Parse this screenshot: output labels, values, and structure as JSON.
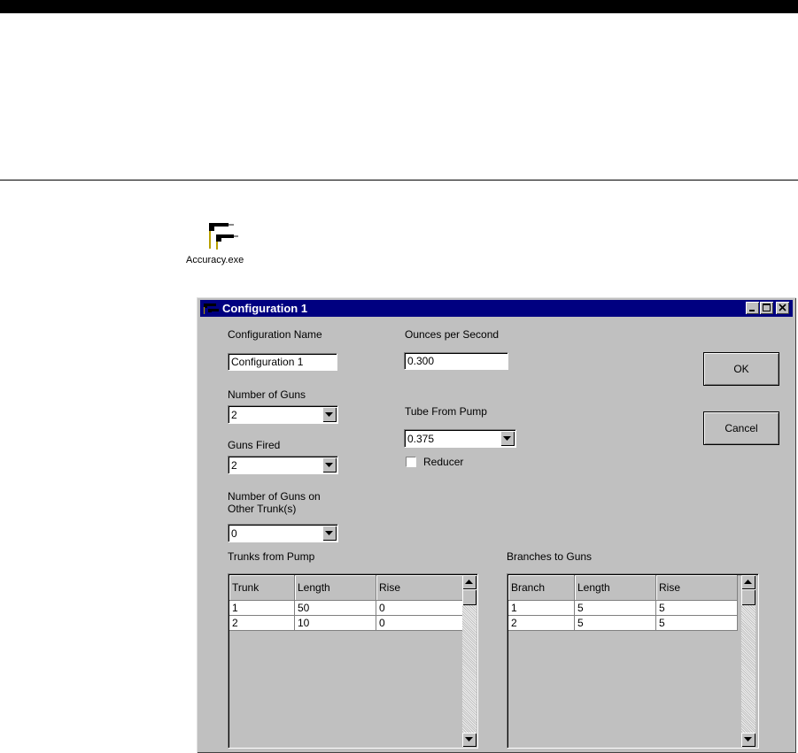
{
  "desktop": {
    "icon_label": "Accuracy.exe",
    "icon_name": "accuracy-app-icon"
  },
  "window": {
    "title": "Configuration 1",
    "controls": [
      "minimize",
      "maximize",
      "close"
    ]
  },
  "form": {
    "config_name_label": "Configuration Name",
    "config_name_value": "Configuration 1",
    "ounces_label": "Ounces per Second",
    "ounces_value": "0.300",
    "num_guns_label": "Number of Guns",
    "num_guns_value": "2",
    "tube_label": "Tube From Pump",
    "tube_value": "0.375",
    "guns_fired_label": "Guns Fired",
    "guns_fired_value": "2",
    "reducer_label": "Reducer",
    "reducer_checked": false,
    "other_trunk_label_line1": "Number of Guns on",
    "other_trunk_label_line2": "Other Trunk(s)",
    "other_trunk_value": "0"
  },
  "buttons": {
    "ok": "OK",
    "cancel": "Cancel"
  },
  "trunks": {
    "label": "Trunks from Pump",
    "columns": [
      "Trunk",
      "Length",
      "Rise"
    ],
    "rows": [
      [
        "1",
        "50",
        "0"
      ],
      [
        "2",
        "10",
        "0"
      ]
    ]
  },
  "branches": {
    "label": "Branches to Guns",
    "columns": [
      "Branch",
      "Length",
      "Rise"
    ],
    "rows": [
      [
        "1",
        "5",
        "5"
      ],
      [
        "2",
        "5",
        "5"
      ]
    ]
  }
}
